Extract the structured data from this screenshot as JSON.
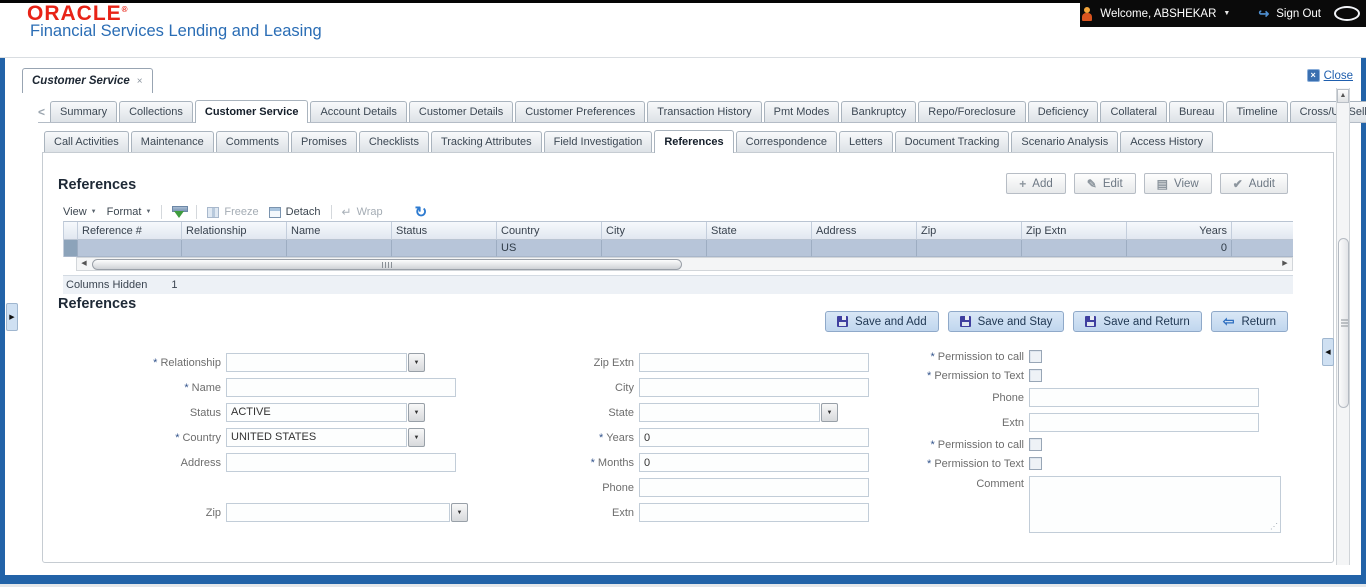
{
  "header": {
    "logo": "ORACLE",
    "logo_mark": "®",
    "tagline": "Financial Services Lending and Leasing",
    "welcome": "Welcome, ABSHEKAR",
    "sign_out": "Sign Out"
  },
  "window_tab": {
    "label": "Customer Service"
  },
  "close_link": {
    "label": "Close"
  },
  "main_tabs": [
    "Summary",
    "Collections",
    "Customer Service",
    "Account Details",
    "Customer Details",
    "Customer Preferences",
    "Transaction History",
    "Pmt Modes",
    "Bankruptcy",
    "Repo/Foreclosure",
    "Deficiency",
    "Collateral",
    "Bureau",
    "Timeline",
    "Cross/Up Sell"
  ],
  "sub_tabs": [
    "Call Activities",
    "Maintenance",
    "Comments",
    "Promises",
    "Checklists",
    "Tracking Attributes",
    "Field Investigation",
    "References",
    "Correspondence",
    "Letters",
    "Document Tracking",
    "Scenario Analysis",
    "Access History"
  ],
  "grid": {
    "title": "References",
    "actions": {
      "add": "Add",
      "edit": "Edit",
      "view": "View",
      "audit": "Audit"
    },
    "toolbar": {
      "view": "View",
      "format": "Format",
      "freeze": "Freeze",
      "detach": "Detach",
      "wrap": "Wrap"
    },
    "columns": [
      "Reference #",
      "Relationship",
      "Name",
      "Status",
      "Country",
      "City",
      "State",
      "Address",
      "Zip",
      "Zip Extn",
      "Years"
    ],
    "row": [
      "",
      "",
      "",
      "",
      "US",
      "",
      "",
      "",
      "",
      "",
      "0"
    ],
    "columns_hidden_label": "Columns Hidden",
    "columns_hidden_value": "1"
  },
  "form": {
    "title": "References",
    "buttons": {
      "save_add": "Save and Add",
      "save_stay": "Save and Stay",
      "save_return": "Save and Return",
      "ret": "Return"
    },
    "left": {
      "relationship_label": "Relationship",
      "relationship_value": "",
      "name_label": "Name",
      "name_value": "",
      "status_label": "Status",
      "status_value": "ACTIVE",
      "country_label": "Country",
      "country_value": "UNITED STATES",
      "address_label": "Address",
      "address_value": "",
      "zip_label": "Zip",
      "zip_value": ""
    },
    "middle": {
      "zip_extn_label": "Zip Extn",
      "zip_extn_value": "",
      "city_label": "City",
      "city_value": "",
      "state_label": "State",
      "state_value": "",
      "years_label": "Years",
      "years_value": "0",
      "months_label": "Months",
      "months_value": "0",
      "phone_label": "Phone",
      "phone_value": "",
      "extn_label": "Extn",
      "extn_value": ""
    },
    "right": {
      "perm_call1_label": "Permission to call",
      "perm_text1_label": "Permission to Text",
      "phone_label": "Phone",
      "phone_value": "",
      "extn_label": "Extn",
      "extn_value": "",
      "perm_call2_label": "Permission to call",
      "perm_text2_label": "Permission to Text",
      "comment_label": "Comment",
      "comment_value": ""
    }
  },
  "icons": {
    "required": "*",
    "dropdown": "▼",
    "caret_down": "▼",
    "tab_prev": "<",
    "tab_next": ">",
    "tab_menu": "▼",
    "close_x": "×",
    "scroll_left": "◀",
    "scroll_right": "▶",
    "scroll_up": "▲",
    "add_plus": "+",
    "edit_pencil": "✎",
    "view_doc": "▤",
    "audit_check": "✔",
    "wrap_arrow": "↵",
    "refresh": "↻",
    "signout_arrow": "↪",
    "return_arrow": "⇦",
    "resize_grip": "⋰"
  }
}
